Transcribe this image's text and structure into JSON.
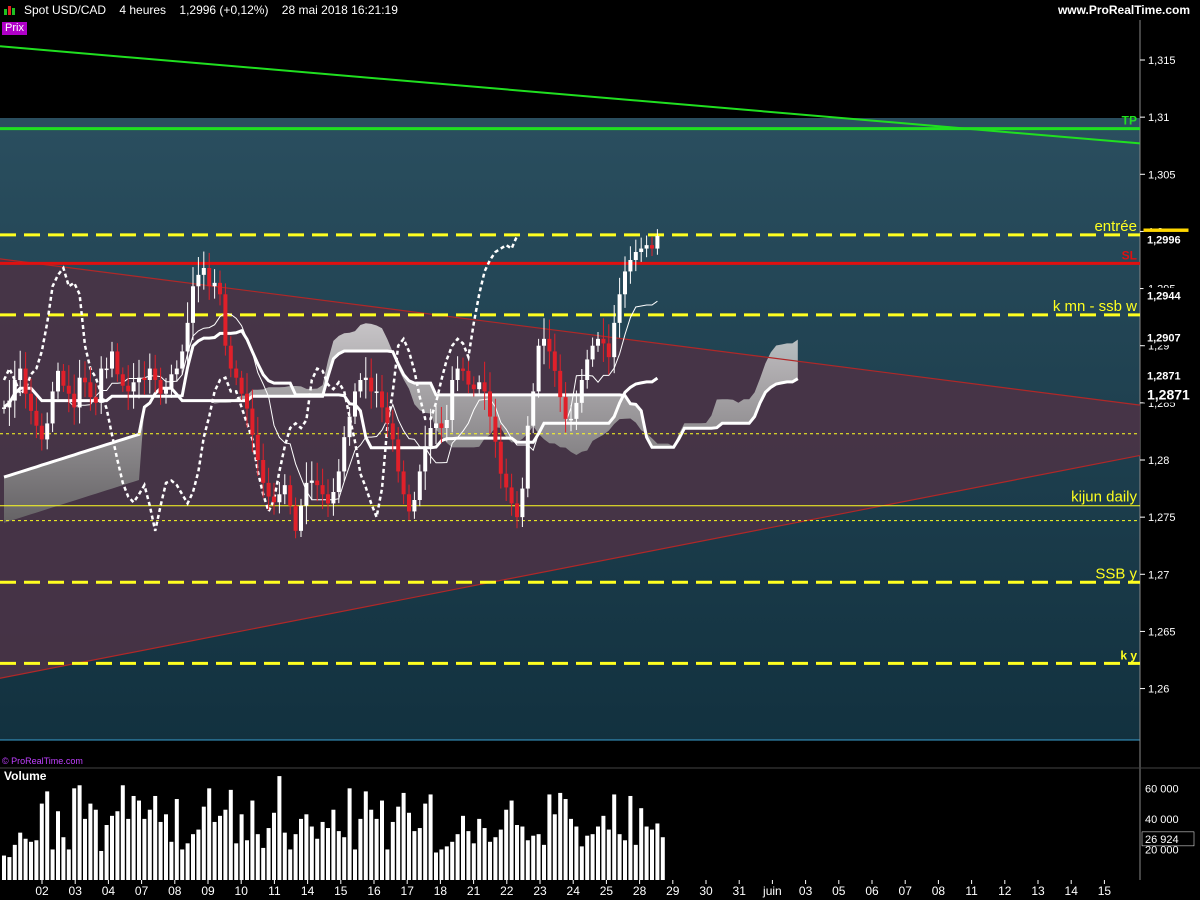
{
  "header": {
    "title": "Spot USD/CAD    4 heures    1,2996 (+0,12%)    28 mai 2018 16:21:19",
    "brand": "www.ProRealTime.com",
    "prix_label": "Prix",
    "copyright": "© ProRealTime.com",
    "volume_label": "Volume"
  },
  "colors": {
    "background": "#000000",
    "panel_top": "#2b4f62",
    "panel_bottom": "#163746",
    "triangle_fill": "#4a3346",
    "up_candle": "#ffffff",
    "down_candle": "#e0202a",
    "level_yellow": "#ffff20",
    "tp_green": "#20e020",
    "sl_red": "#e01010",
    "trend_red": "#b02828"
  },
  "price_axis": {
    "ticks": [
      "1,315",
      "1,31",
      "1,305",
      "1,3",
      "1,295",
      "1,29",
      "1,285",
      "1,28",
      "1,275",
      "1,27",
      "1,265",
      "1,26"
    ],
    "tick_values": [
      1.315,
      1.31,
      1.305,
      1.3,
      1.295,
      1.29,
      1.285,
      1.28,
      1.275,
      1.27,
      1.265,
      1.26
    ],
    "ylim": [
      1.2555,
      1.3185
    ],
    "badges": [
      {
        "text": "1,2996",
        "value": 1.2996,
        "style": "current"
      },
      {
        "text": "1,2996",
        "value": 1.2993,
        "style": "plain"
      },
      {
        "text": "1,2944",
        "value": 1.2944,
        "style": "plain"
      },
      {
        "text": "1,2907",
        "value": 1.2907,
        "style": "plain"
      },
      {
        "text": "1,2871",
        "value": 1.2874,
        "style": "plain"
      },
      {
        "text": "1,2871",
        "value": 1.2858,
        "style": "large"
      }
    ]
  },
  "volume_axis": {
    "ticks": [
      "60 000",
      "40 000",
      "26 924",
      "20 000"
    ],
    "tick_values": [
      60000,
      40000,
      26924,
      20000
    ],
    "ylim": [
      0,
      72000
    ]
  },
  "date_axis": {
    "labels": [
      "02",
      "03",
      "04",
      "07",
      "08",
      "09",
      "10",
      "11",
      "14",
      "15",
      "16",
      "17",
      "18",
      "21",
      "22",
      "23",
      "24",
      "25",
      "28",
      "29",
      "30",
      "31",
      "juin",
      "03",
      "05",
      "06",
      "07",
      "08",
      "11",
      "12",
      "13",
      "14",
      "15"
    ]
  },
  "levels": [
    {
      "label": "TP",
      "value": 1.309,
      "color": "#20e020",
      "style": "solid"
    },
    {
      "label": "entrée",
      "value": 1.2997,
      "color": "#ffff20",
      "style": "dashed"
    },
    {
      "label": "SL",
      "value": 1.2972,
      "color": "#e01010",
      "style": "solid"
    },
    {
      "label": "k mn - ssb w",
      "value": 1.2927,
      "color": "#ffff20",
      "style": "dashed"
    },
    {
      "label": "",
      "value": 1.2823,
      "color": "#ffff20",
      "style": "dotted"
    },
    {
      "label": "kijun daily",
      "value": 1.276,
      "color": "#ffff20",
      "style": "thin"
    },
    {
      "label": "",
      "value": 1.2747,
      "color": "#ffff20",
      "style": "dotted"
    },
    {
      "label": "SSB y",
      "value": 1.2693,
      "color": "#ffff20",
      "style": "dashed"
    },
    {
      "label": "k y",
      "value": 1.2622,
      "color": "#ffff20",
      "style": "dashed"
    }
  ],
  "chart_data": {
    "type": "candlestick",
    "symbol": "Spot USD/CAD",
    "timeframe": "4 heures",
    "last_price": 1.2996,
    "change_pct": 0.12,
    "closes": [
      1.2846,
      1.2852,
      1.287,
      1.288,
      1.2858,
      1.2843,
      1.283,
      1.2818,
      1.2832,
      1.286,
      1.2878,
      1.2865,
      1.2858,
      1.2846,
      1.2872,
      1.2868,
      1.2855,
      1.285,
      1.288,
      1.288,
      1.2895,
      1.2875,
      1.2865,
      1.286,
      1.2868,
      1.2872,
      1.287,
      1.288,
      1.287,
      1.2858,
      1.2862,
      1.2875,
      1.288,
      1.2895,
      1.292,
      1.2952,
      1.2962,
      1.2968,
      1.2952,
      1.2955,
      1.2945,
      1.29,
      1.288,
      1.2872,
      1.2858,
      1.2845,
      1.2822,
      1.28,
      1.278,
      1.2768,
      1.2763,
      1.277,
      1.2778,
      1.276,
      1.2738,
      1.276,
      1.278,
      1.2782,
      1.2778,
      1.277,
      1.2762,
      1.2772,
      1.279,
      1.282,
      1.2838,
      1.286,
      1.287,
      1.2872,
      1.286,
      1.286,
      1.2846,
      1.2832,
      1.2818,
      1.279,
      1.277,
      1.2755,
      1.2765,
      1.279,
      1.2812,
      1.2828,
      1.2832,
      1.2828,
      1.2835,
      1.287,
      1.288,
      1.2878,
      1.2866,
      1.2862,
      1.2868,
      1.286,
      1.2838,
      1.2816,
      1.2788,
      1.2776,
      1.2762,
      1.275,
      1.2775,
      1.283,
      1.286,
      1.29,
      1.2906,
      1.2895,
      1.2878,
      1.2855,
      1.2836,
      1.2836,
      1.285,
      1.287,
      1.2888,
      1.29,
      1.2906,
      1.2902,
      1.289,
      1.292,
      1.2945,
      1.2965,
      1.2975,
      1.2982,
      1.2985,
      1.2988,
      1.2985,
      1.2996
    ],
    "volumes": [
      16000,
      15000,
      23000,
      31000,
      27000,
      25000,
      26000,
      50000,
      58000,
      20000,
      45000,
      28000,
      20000,
      60000,
      62000,
      40000,
      50000,
      46000,
      19000,
      36000,
      42000,
      45000,
      62000,
      40000,
      55000,
      52000,
      40000,
      46000,
      55000,
      38000,
      43000,
      25000,
      53000,
      20000,
      24000,
      30000,
      33000,
      48000,
      60000,
      38000,
      42000,
      46000,
      59000,
      24000,
      43000,
      26000,
      52000,
      30000,
      21000,
      34000,
      44000,
      68000,
      31000,
      20000,
      30000,
      40000,
      43000,
      35000,
      27000,
      38000,
      34000,
      46000,
      32000,
      28000,
      60000,
      20000,
      40000,
      58000,
      46000,
      40000,
      52000,
      20000,
      38000,
      48000,
      57000,
      44000,
      32000,
      34000,
      50000,
      56000,
      18000,
      20000,
      22000,
      25000,
      30000,
      42000,
      32000,
      24000,
      40000,
      34000,
      25000,
      28000,
      33000,
      46000,
      52000,
      36000,
      35000,
      26000,
      29000,
      30000,
      23000,
      56000,
      43000,
      57000,
      53000,
      40000,
      35000,
      22000,
      29000,
      30000,
      35000,
      42000,
      33000,
      56000,
      30000,
      26000,
      55000,
      23000,
      47000,
      35000,
      33000,
      37000,
      28000
    ],
    "price_ylim": [
      1.2555,
      1.3185
    ],
    "trendlines": [
      {
        "name": "tp-trend",
        "color": "#20e020",
        "points": [
          [
            0,
            1.3162
          ],
          [
            1140,
            1.3077
          ]
        ]
      },
      {
        "name": "triangle-upper",
        "color": "#b02828",
        "points": [
          [
            0,
            1.2976
          ],
          [
            1140,
            1.2848
          ]
        ]
      },
      {
        "name": "triangle-lower",
        "color": "#b02828",
        "points": [
          [
            0,
            1.2609
          ],
          [
            1140,
            1.2804
          ]
        ]
      }
    ]
  }
}
